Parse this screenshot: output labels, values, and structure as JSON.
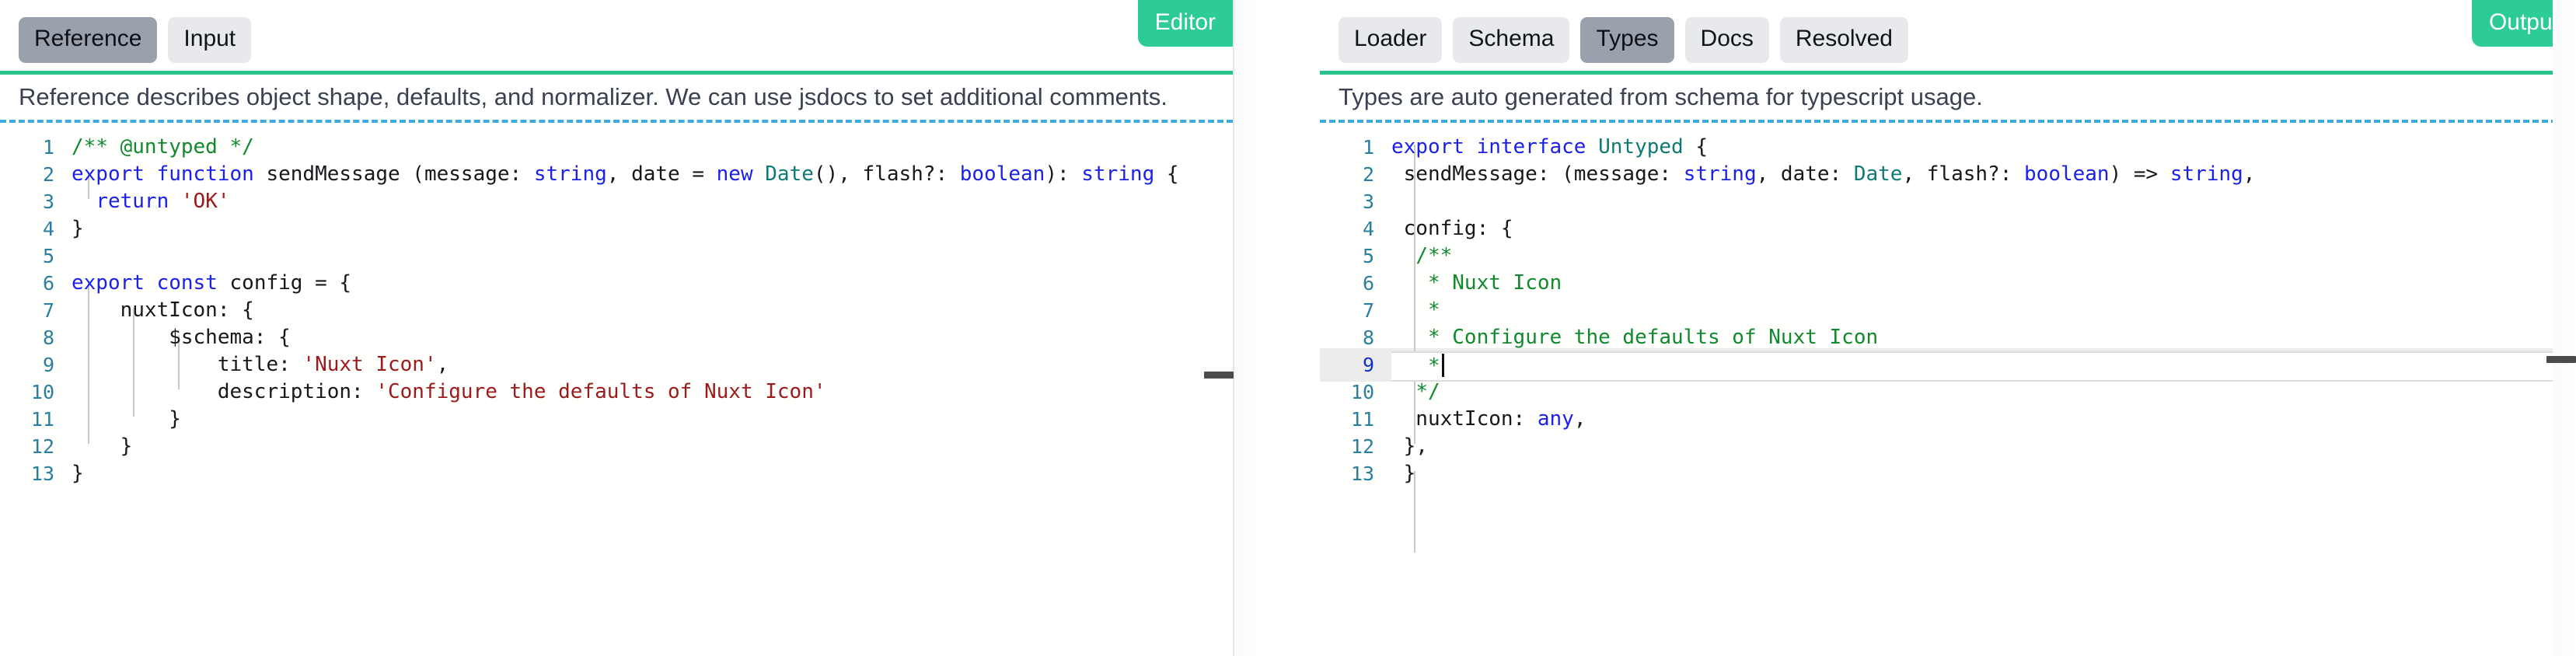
{
  "left_panel": {
    "badge": "Editor",
    "tabs": [
      {
        "label": "Reference",
        "active": true
      },
      {
        "label": "Input",
        "active": false
      }
    ],
    "description": "Reference describes object shape, defaults, and normalizer. We can use jsdocs to set additional comments.",
    "code_lines": [
      {
        "num": "1",
        "text": "/** @untyped */"
      },
      {
        "num": "2",
        "text": "export function sendMessage (message: string, date = new Date(), flash?: boolean): string {"
      },
      {
        "num": "3",
        "text": "  return 'OK'"
      },
      {
        "num": "4",
        "text": "}"
      },
      {
        "num": "5",
        "text": ""
      },
      {
        "num": "6",
        "text": "export const config = {"
      },
      {
        "num": "7",
        "text": "    nuxtIcon: {"
      },
      {
        "num": "8",
        "text": "        $schema: {"
      },
      {
        "num": "9",
        "text": "            title: 'Nuxt Icon',"
      },
      {
        "num": "10",
        "text": "            description: 'Configure the defaults of Nuxt Icon'"
      },
      {
        "num": "11",
        "text": "        }"
      },
      {
        "num": "12",
        "text": "    }"
      },
      {
        "num": "13",
        "text": "}"
      }
    ]
  },
  "right_panel": {
    "badge": "Output",
    "tabs": [
      {
        "label": "Loader",
        "active": false
      },
      {
        "label": "Schema",
        "active": false
      },
      {
        "label": "Types",
        "active": true
      },
      {
        "label": "Docs",
        "active": false
      },
      {
        "label": "Resolved",
        "active": false
      }
    ],
    "description": "Types are auto generated from schema for typescript usage.",
    "code_lines": [
      {
        "num": "1",
        "text": "export interface Untyped {"
      },
      {
        "num": "2",
        "text": " sendMessage: (message: string, date: Date, flash?: boolean) => string,"
      },
      {
        "num": "3",
        "text": ""
      },
      {
        "num": "4",
        "text": " config: {"
      },
      {
        "num": "5",
        "text": "  /**"
      },
      {
        "num": "6",
        "text": "   * Nuxt Icon"
      },
      {
        "num": "7",
        "text": "   *"
      },
      {
        "num": "8",
        "text": "   * Configure the defaults of Nuxt Icon"
      },
      {
        "num": "9",
        "text": "   * "
      },
      {
        "num": "10",
        "text": "  */"
      },
      {
        "num": "11",
        "text": "  nuxtIcon: any,"
      },
      {
        "num": "12",
        "text": " },"
      },
      {
        "num": "13",
        "text": " }"
      }
    ],
    "active_line": "9"
  },
  "colors": {
    "accent_green": "#2ecc95",
    "divider_green": "#28c38a",
    "divider_blue_dashed": "#3fa9e0",
    "tab_inactive_bg": "#e7e9ec",
    "tab_active_bg": "#9aa1ac",
    "keyword": "#1c21e8",
    "comment": "#118a2e",
    "string": "#9c1a1a",
    "type": "#0f7a75",
    "line_number": "#2a7f9e"
  }
}
